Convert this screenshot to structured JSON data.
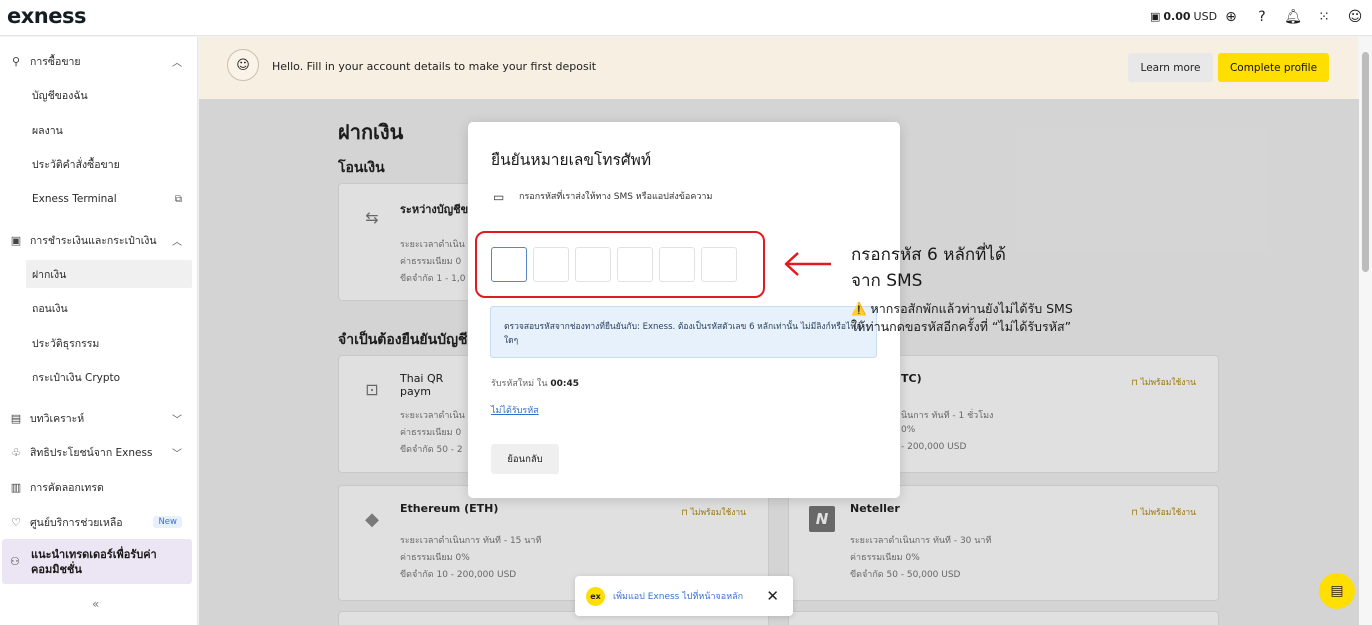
{
  "app": {
    "logo": "exness",
    "balance": "0.00",
    "currency": "USD"
  },
  "topbar_icons": [
    "wallet-icon",
    "globe-icon",
    "help-icon",
    "bell-icon",
    "apps-grid-icon",
    "profile-icon"
  ],
  "sidebar": {
    "trading": "การซื้อขาย",
    "my_accounts": "บัญชีของฉัน",
    "performance": "ผลงาน",
    "order_history": "ประวัติคำสั่งซื้อขาย",
    "terminal": "Exness Terminal",
    "payments": "การชำระเงินและกระเป๋าเงิน",
    "deposit": "ฝากเงิน",
    "withdraw": "ถอนเงิน",
    "transactions": "ประวัติธุรกรรม",
    "crypto_wallet": "กระเป๋าเงิน Crypto",
    "analytics": "บทวิเคราะห์",
    "benefits": "สิทธิประโยชน์จาก Exness",
    "copy_trading": "การคัดลอกเทรด",
    "help_center": "ศูนย์บริการช่วยเหลือ",
    "new_badge": "New",
    "referral": "แนะนำเทรดเดอร์เพื่อรับค่าคอมมิชชั่น",
    "collapse": "«"
  },
  "banner": {
    "message": "Hello. Fill in your account details to make your first deposit",
    "learn_more": "Learn more",
    "complete_profile": "Complete profile"
  },
  "main": {
    "title": "ฝากเงิน",
    "transfer_section": "โอนเงิน",
    "verify_section": "จำเป็นต้องยืนยันบัญชี",
    "cards": [
      {
        "name": "ระหว่างบัญชีข",
        "l1": "ระยะเวลาดำเนิน",
        "l2": "ค่าธรรมเนียม 0",
        "l3": "ขีดจำกัด 1 - 1,0",
        "badge": ""
      },
      {
        "name": "Thai QR paym",
        "l1": "ระยะเวลาดำเนิน",
        "l2": "ค่าธรรมเนียม 0",
        "l3": "ขีดจำกัด 50 - 2",
        "badge": ""
      },
      {
        "name": "TC)",
        "l1": "นินการ ทันที - 1 ชั่วโมง",
        "l2": "0%",
        "l3": "- 200,000 USD",
        "badge": "ไม่พร้อมใช้งาน"
      },
      {
        "name": "Ethereum (ETH)",
        "l1": "ระยะเวลาดำเนินการ ทันที - 15 นาที",
        "l2": "ค่าธรรมเนียม 0%",
        "l3": "ขีดจำกัด 10 - 200,000 USD",
        "badge": "ไม่พร้อมใช้งาน"
      },
      {
        "name": "Neteller",
        "l1": "ระยะเวลาดำเนินการ ทันที - 30 นาที",
        "l2": "ค่าธรรมเนียม 0%",
        "l3": "ขีดจำกัด 50 - 50,000 USD",
        "badge": "ไม่พร้อมใช้งาน"
      }
    ]
  },
  "modal": {
    "title": "ยืนยันหมายเลขโทรศัพท์",
    "info": "กรอกรหัสที่เราส่งให้ทาง SMS หรือแอปส่งข้อความ",
    "hint": "ตรวจสอบรหัสจากช่องทางที่ยืนยันกับ: Exness. ต้องเป็นรหัสตัวเลข 6 หลักเท่านั้น ไม่มีลิงก์หรือไฟล์ใดๆ",
    "resend_prefix": "รับรหัสใหม่ ใน",
    "resend_timer": "00:45",
    "no_code": "ไม่ได้รับรหัส",
    "back": "ย้อนกลับ"
  },
  "annotation": {
    "line1": "กรอกรหัส 6 หลักที่ได้",
    "line2": "จาก SMS",
    "warn1": "⚠️ หากรอสักพักแล้วท่านยังไม่ได้รับ SMS",
    "warn2": "ให้ท่านกดขอรหัสอีกครั้งที่ “ไม่ได้รับรหัส”"
  },
  "toast": {
    "logo": "ex",
    "text": "เพิ่มแอป Exness ไปที่หน้าจอหลัก",
    "close": "✕"
  }
}
